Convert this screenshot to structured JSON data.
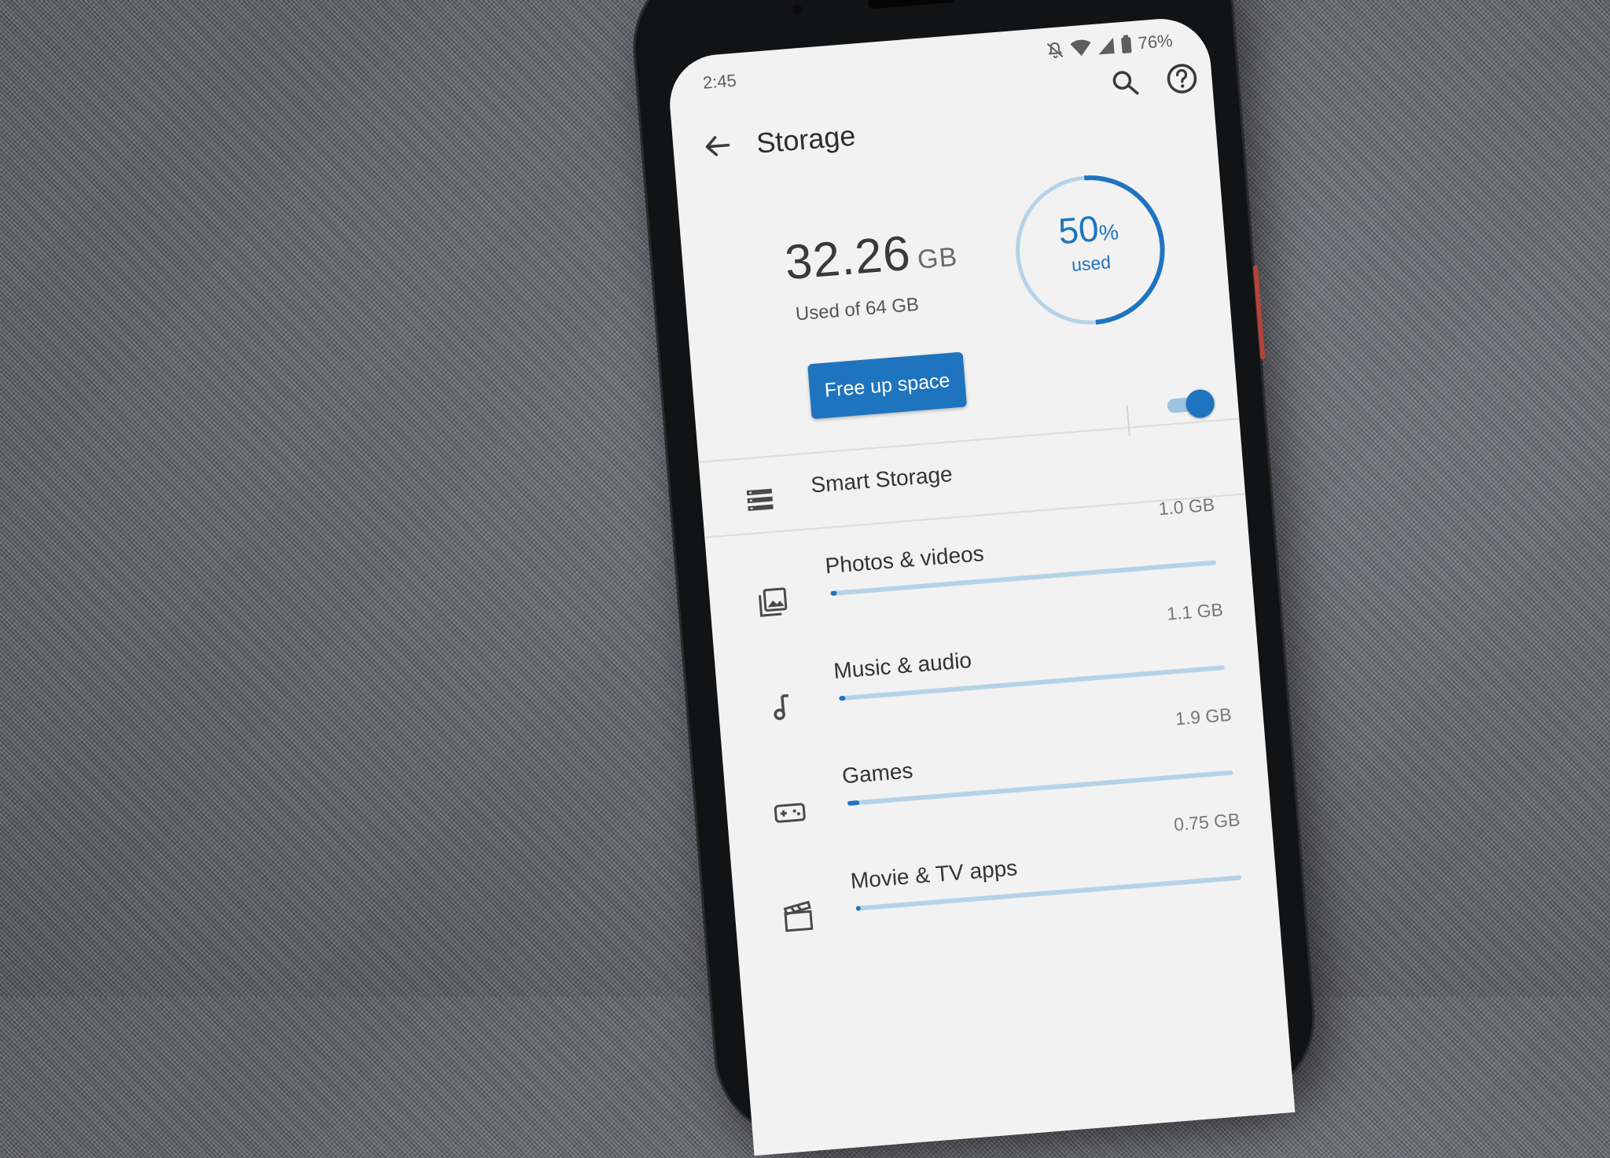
{
  "status_bar": {
    "time": "2:45",
    "battery": "76%",
    "icons": [
      "bell-off-icon",
      "wifi-icon",
      "cell-signal-icon",
      "battery-icon"
    ]
  },
  "app_bar": {
    "title": "Storage",
    "icons": [
      "back-arrow-icon",
      "search-icon",
      "help-icon"
    ]
  },
  "summary": {
    "used_value": "32.26",
    "used_unit": "GB",
    "used_of": "Used of 64 GB",
    "free_up_label": "Free up space",
    "percent_value": "50",
    "percent_sign": "%",
    "percent_label": "used",
    "percent_fraction": 0.5
  },
  "smart_storage": {
    "label": "Smart Storage",
    "enabled": true
  },
  "categories": [
    {
      "label": "Photos & videos",
      "size": "1.0 GB",
      "icon": "photo-library-icon",
      "fraction": 0.016
    },
    {
      "label": "Music & audio",
      "size": "1.1 GB",
      "icon": "music-note-icon",
      "fraction": 0.017
    },
    {
      "label": "Games",
      "size": "1.9 GB",
      "icon": "gamepad-icon",
      "fraction": 0.03
    },
    {
      "label": "Movie & TV apps",
      "size": "0.75 GB",
      "icon": "movie-clapper-icon",
      "fraction": 0.012
    }
  ],
  "colors": {
    "accent": "#1f74bf",
    "track": "#b5d3e8",
    "screen_bg": "#f2f2f2"
  }
}
